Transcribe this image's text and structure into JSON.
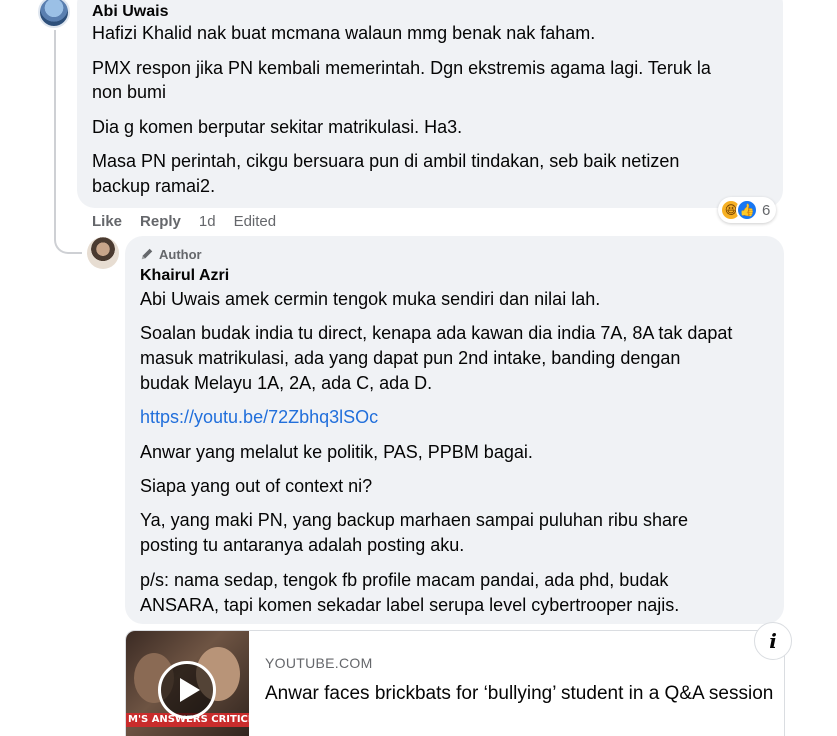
{
  "comment1": {
    "author": "Abi Uwais",
    "paragraphs": [
      "Hafizi Khalid nak buat mcmana walaun mmg benak nak faham.",
      "PMX respon jika PN kembali memerintah. Dgn ekstremis agama lagi. Teruk la",
      "non bumi",
      "Dia g komen berputar sekitar matrikulasi. Ha3.",
      "Masa PN perintah, cikgu bersuara pun di ambil tindakan, seb baik netizen",
      "backup ramai2."
    ],
    "actions": {
      "like": "Like",
      "reply": "Reply",
      "time": "1d",
      "edited": "Edited"
    },
    "reactions": {
      "icons": [
        "haha-icon",
        "like-icon"
      ],
      "count": "6"
    }
  },
  "comment2": {
    "badge": "Author",
    "author": "Khairul Azri",
    "paragraphs": [
      "Abi Uwais amek cermin tengok muka sendiri dan nilai lah.",
      "Soalan budak india tu direct, kenapa ada kawan dia india 7A, 8A tak dapat",
      "masuk matrikulasi, ada yang dapat pun 2nd intake, banding dengan",
      "budak Melayu 1A, 2A, ada C, ada D.",
      "https://youtu.be/72Zbhq3lSOc",
      "Anwar yang melalut ke politik, PAS, PPBM bagai.",
      "Siapa yang out of context ni?",
      "Ya, yang maki PN, yang backup marhaen sampai puluhan ribu share",
      "posting tu antaranya adalah posting aku.",
      "p/s: nama sedap, tengok fb profile macam pandai, ada phd, budak",
      "ANSARA, tapi komen sekadar label serupa level cybertrooper najis."
    ]
  },
  "link_preview": {
    "thumbnail_caption": "M'S ANSWERS CRITICIS",
    "source": "YOUTUBE.COM",
    "title": "Anwar faces brickbats for ‘bullying’ student in a Q&A session"
  },
  "colors": {
    "bubble": "#f0f2f5",
    "link": "#216fdb",
    "muted": "#65676b"
  }
}
